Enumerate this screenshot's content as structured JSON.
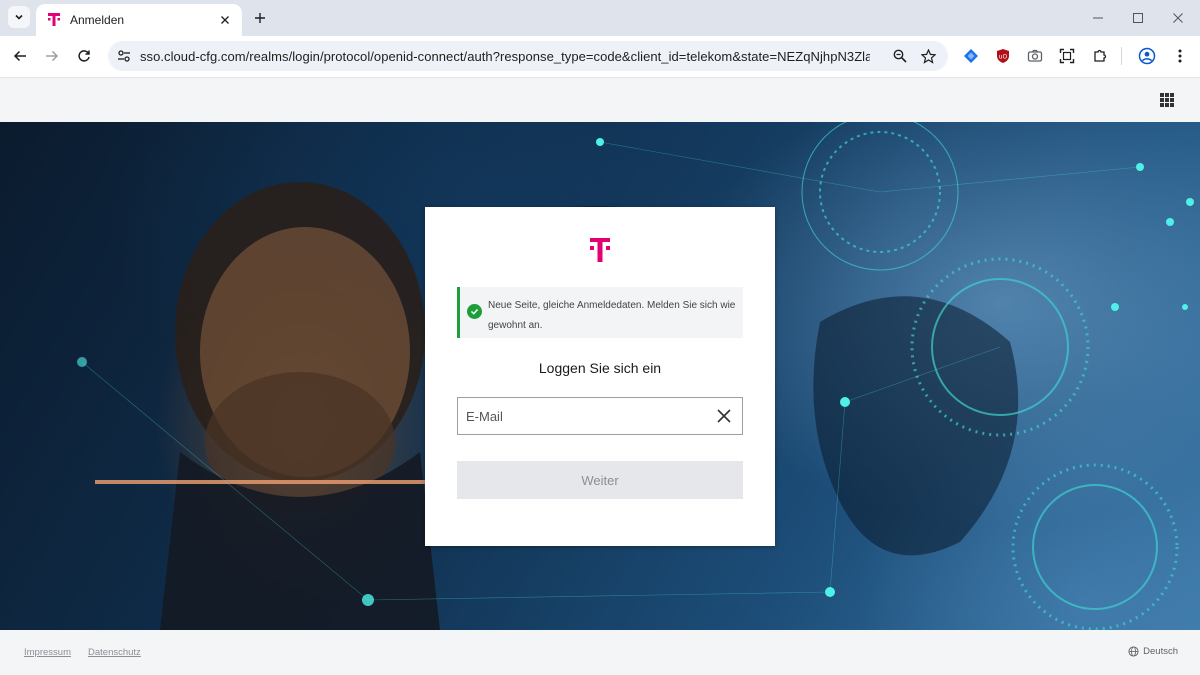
{
  "browser": {
    "tab_title": "Anmelden",
    "url": "sso.cloud-cfg.com/realms/login/protocol/openid-connect/auth?response_type=code&client_id=telekom&state=NEZqNjhpN3Zla3ky..."
  },
  "brand": {
    "accent": "#e20074",
    "logo_icon": "telekom-t-logo"
  },
  "login": {
    "notice": "Neue Seite, gleiche Anmeldedaten. Melden Sie sich wie gewohnt an.",
    "notice_color": "#1e9e3a",
    "title": "Loggen Sie sich ein",
    "email_placeholder": "E-Mail",
    "email_value": "",
    "next_label": "Weiter"
  },
  "footer": {
    "impressum": "Impressum",
    "datenschutz": "Datenschutz",
    "language": "Deutsch"
  }
}
